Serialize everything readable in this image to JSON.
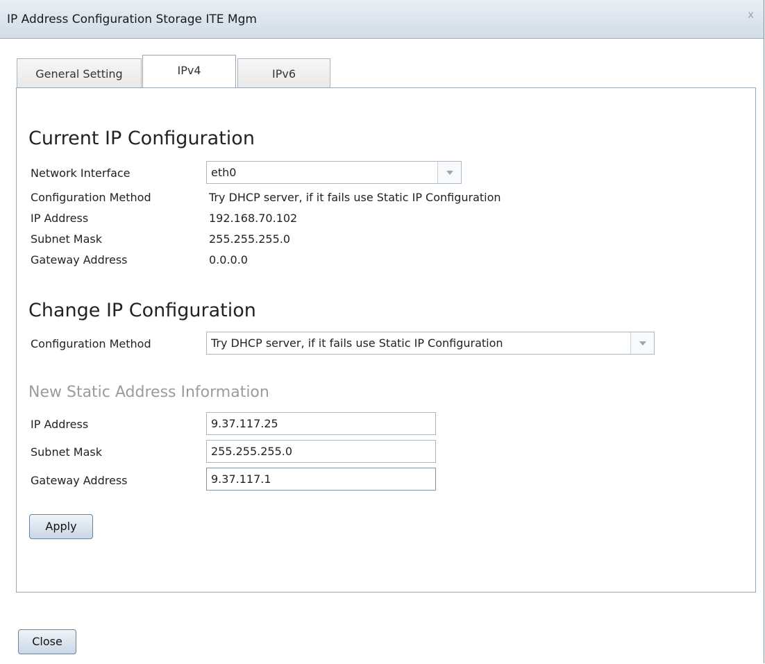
{
  "window": {
    "title": "IP Address Configuration Storage ITE Mgm",
    "close_glyph": "x"
  },
  "tabs": [
    {
      "label": "General Setting",
      "active": false
    },
    {
      "label": "IPv4",
      "active": true
    },
    {
      "label": "IPv6",
      "active": false
    }
  ],
  "current": {
    "heading": "Current IP Configuration",
    "network_interface_label": "Network Interface",
    "network_interface_value": "eth0",
    "config_method_label": "Configuration Method",
    "config_method_value": "Try DHCP server, if it fails use Static IP Configuration",
    "ip_label": "IP Address",
    "ip_value": "192.168.70.102",
    "subnet_label": "Subnet Mask",
    "subnet_value": "255.255.255.0",
    "gateway_label": "Gateway Address",
    "gateway_value": "0.0.0.0"
  },
  "change": {
    "heading": "Change IP Configuration",
    "config_method_label": "Configuration Method",
    "config_method_value": "Try DHCP server, if it fails use Static IP Configuration"
  },
  "static": {
    "heading": "New Static Address Information",
    "ip_label": "IP Address",
    "ip_value": "9.37.117.25",
    "subnet_label": "Subnet Mask",
    "subnet_value": "255.255.255.0",
    "gateway_label": "Gateway Address",
    "gateway_value": "9.37.117.1"
  },
  "buttons": {
    "apply": "Apply",
    "close": "Close"
  },
  "icons": {
    "close": "close-icon",
    "dropdown": "chevron-down-icon"
  }
}
